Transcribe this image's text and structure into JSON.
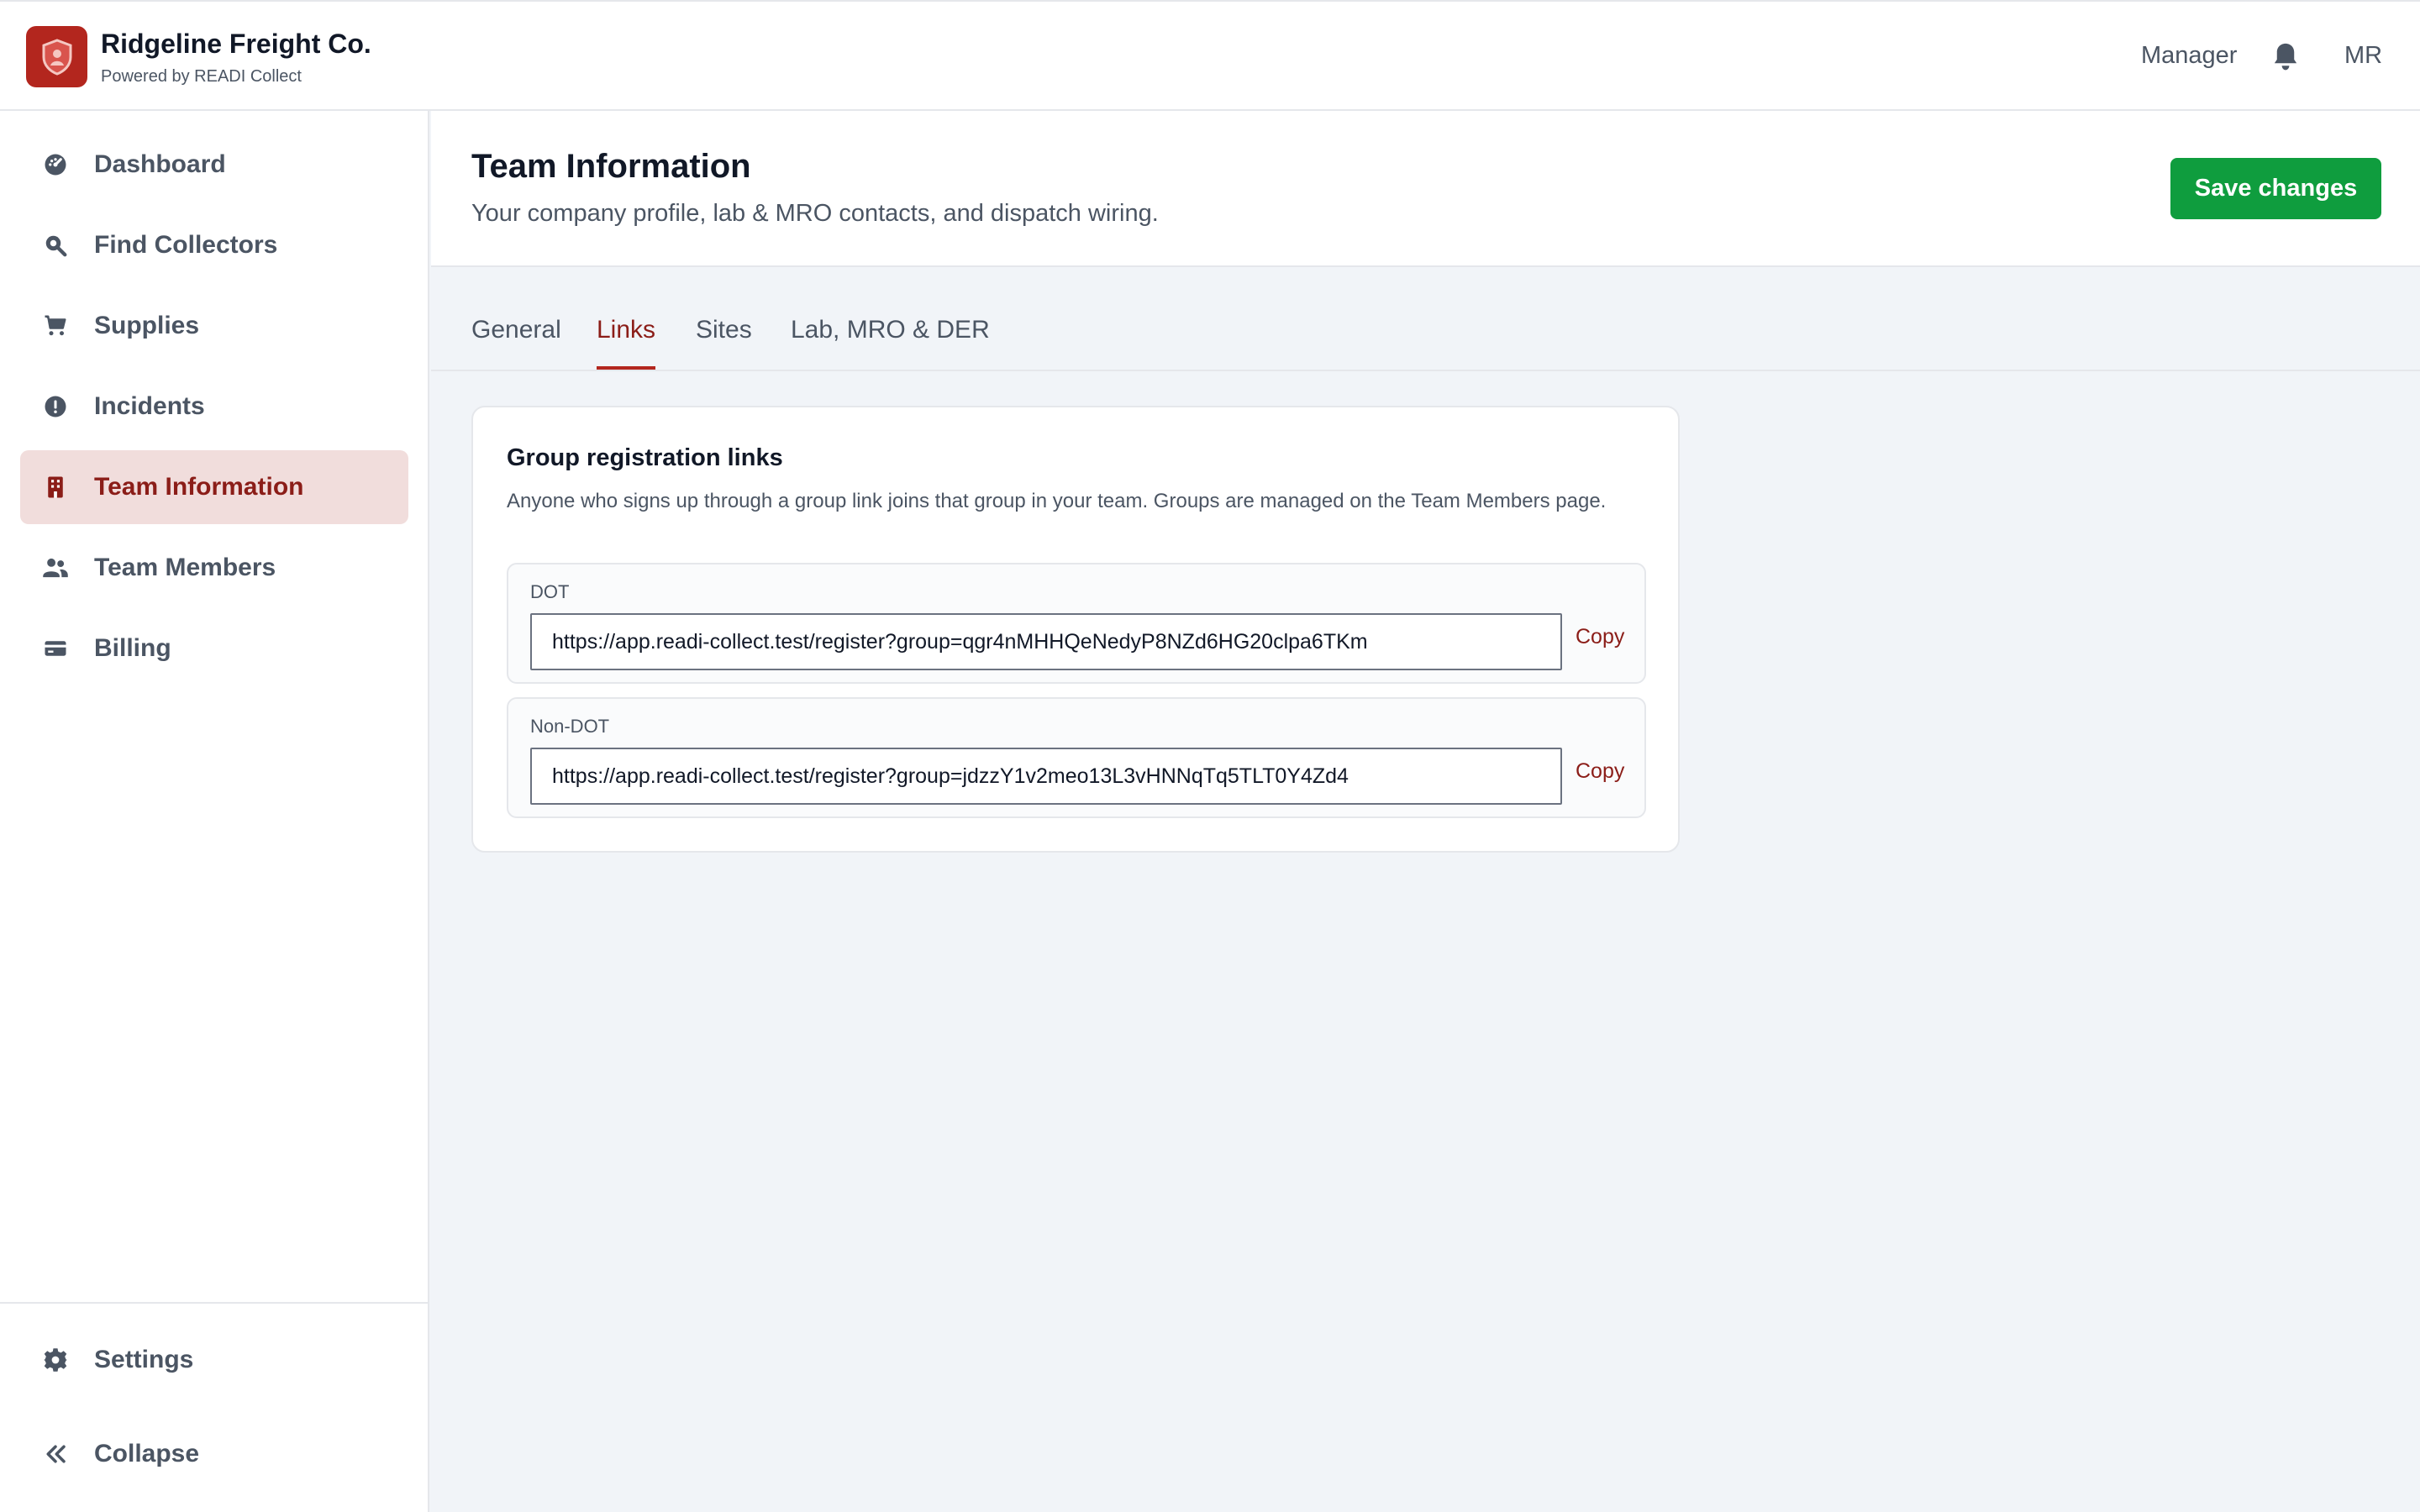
{
  "header": {
    "company_name": "Ridgeline Freight Co.",
    "powered_by": "Powered by READI Collect",
    "role": "Manager",
    "avatar_initials": "MR"
  },
  "sidebar": {
    "items": [
      {
        "label": "Dashboard",
        "icon": "dashboard-icon"
      },
      {
        "label": "Find Collectors",
        "icon": "search-icon"
      },
      {
        "label": "Supplies",
        "icon": "cart-icon"
      },
      {
        "label": "Incidents",
        "icon": "alert-icon"
      },
      {
        "label": "Team Information",
        "icon": "building-icon",
        "active": true
      },
      {
        "label": "Team Members",
        "icon": "users-icon"
      },
      {
        "label": "Billing",
        "icon": "credit-card-icon"
      }
    ],
    "settings_label": "Settings",
    "collapse_label": "Collapse"
  },
  "page": {
    "title": "Team Information",
    "subtitle": "Your company profile, lab & MRO contacts, and dispatch wiring.",
    "save_label": "Save changes"
  },
  "tabs": [
    {
      "label": "General"
    },
    {
      "label": "Links",
      "active": true
    },
    {
      "label": "Sites"
    },
    {
      "label": "Lab, MRO & DER"
    }
  ],
  "card": {
    "title": "Group registration links",
    "description": "Anyone who signs up through a group link joins that group in your team. Groups are managed on the Team Members page.",
    "links": [
      {
        "label": "DOT",
        "url": "https://app.readi-collect.test/register?group=qgr4nMHHQeNedyP8NZd6HG20clpa6TKm",
        "copy_label": "Copy"
      },
      {
        "label": "Non-DOT",
        "url": "https://app.readi-collect.test/register?group=jdzzY1v2meo13L3vHNNqTq5TLT0Y4Zd4",
        "copy_label": "Copy"
      }
    ]
  },
  "colors": {
    "brand": "#b3261e",
    "active_text": "#8b1d18",
    "active_bg": "#f1dddc",
    "primary_button": "#0f9d3e"
  }
}
